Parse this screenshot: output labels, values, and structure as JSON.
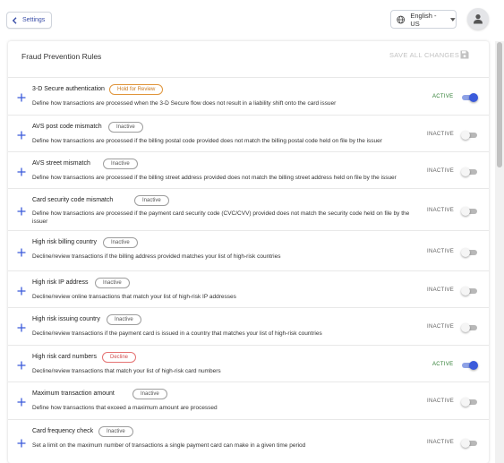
{
  "header": {
    "back_label": "Settings",
    "language_label": "English - US"
  },
  "card": {
    "title": "Fraud Prevention Rules",
    "save_all_label": "SAVE ALL CHANGES"
  },
  "rules": [
    {
      "name": "3-D Secure authentication",
      "chip": "Hold for Review",
      "chip_kind": "hold",
      "desc": "Define how transactions are processed when the 3-D Secure flow does not result in a liability shift onto the card issuer",
      "status": "ACTIVE",
      "on": true
    },
    {
      "name": "AVS post code mismatch",
      "chip": "Inactive",
      "chip_kind": "neutral",
      "desc": "Define how transactions are processed if the billing postal code provided does not match the billing postal code held on file by the issuer",
      "status": "INACTIVE",
      "on": false
    },
    {
      "name": "AVS street mismatch",
      "chip": "Inactive",
      "chip_kind": "neutral",
      "desc": "Define how transactions are processed if the billing street address provided does not match the billing street address held on file by the issuer",
      "status": "INACTIVE",
      "on": false
    },
    {
      "name": "Card security code mismatch",
      "chip": "Inactive",
      "chip_kind": "neutral",
      "desc": "Define how transactions are processed if the payment card security code (CVC/CVV) provided does not match the security code held on file by the issuer",
      "status": "INACTIVE",
      "on": false
    },
    {
      "name": "High risk billing country",
      "chip": "Inactive",
      "chip_kind": "neutral",
      "desc": "Decline/review transactions if the billing address provided matches your list of high-risk countries",
      "status": "INACTIVE",
      "on": false
    },
    {
      "name": "High risk IP address",
      "chip": "Inactive",
      "chip_kind": "neutral",
      "desc": "Decline/review online transactions that match your list of high-risk IP addresses",
      "status": "INACTIVE",
      "on": false
    },
    {
      "name": "High risk issuing country",
      "chip": "Inactive",
      "chip_kind": "neutral",
      "desc": "Decline/review transactions if the payment card is issued in a country that matches your list of high-risk countries",
      "status": "INACTIVE",
      "on": false
    },
    {
      "name": "High risk card numbers",
      "chip": "Decline",
      "chip_kind": "decline",
      "desc": "Decline/review transactions that match your list of high-risk card numbers",
      "status": "ACTIVE",
      "on": true
    },
    {
      "name": "Maximum transaction amount",
      "chip": "Inactive",
      "chip_kind": "neutral",
      "desc": "Define how transactions that exceed a maximum amount are processed",
      "status": "INACTIVE",
      "on": false
    },
    {
      "name": "Card frequency check",
      "chip": "Inactive",
      "chip_kind": "neutral",
      "desc": "Set a limit on the maximum number of transactions a single payment card can make in a given time period",
      "status": "INACTIVE",
      "on": false
    }
  ],
  "colors": {
    "accent": "#3b5bdb",
    "active_text": "#2e7d32",
    "hold_chip": "#e0953b",
    "decline_chip": "#e57373"
  },
  "icons": {
    "back": "chevron-left-icon",
    "language": "globe-icon",
    "language_caret": "caret-down-icon",
    "avatar": "user-icon",
    "save": "save-icon",
    "expand": "plus-icon"
  }
}
